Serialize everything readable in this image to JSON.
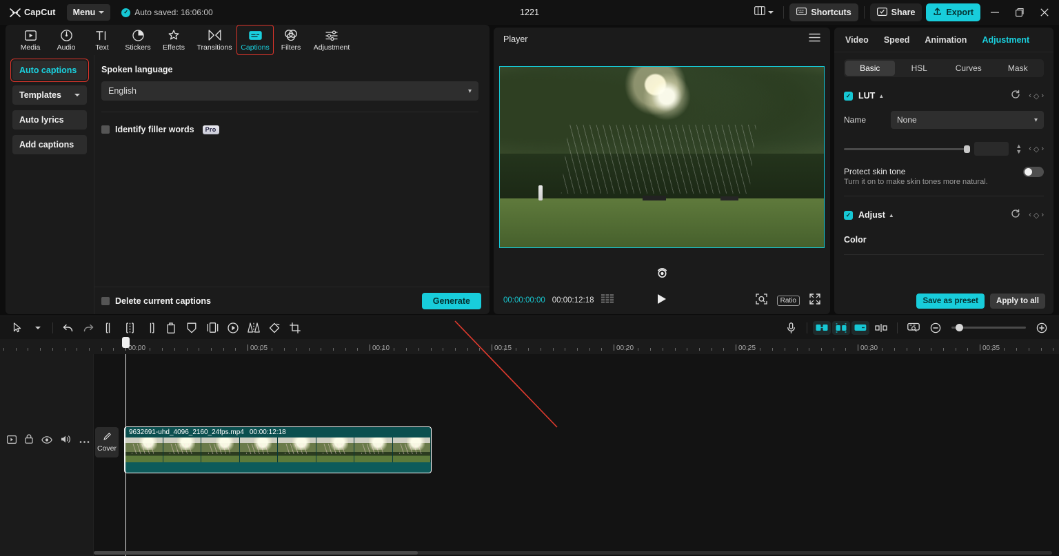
{
  "top_bar": {
    "brand": "CapCut",
    "menu_label": "Menu",
    "autosave": "Auto saved: 16:06:00",
    "project_title": "1221",
    "shortcuts_label": "Shortcuts",
    "share_label": "Share",
    "export_label": "Export",
    "minimize": "—",
    "maximize": "❐",
    "close": "✕"
  },
  "toolbar": {
    "items": [
      {
        "label": "Media",
        "icon": "media-icon",
        "active": false
      },
      {
        "label": "Audio",
        "icon": "audio-icon",
        "active": false
      },
      {
        "label": "Text",
        "icon": "text-icon",
        "active": false
      },
      {
        "label": "Stickers",
        "icon": "stickers-icon",
        "active": false
      },
      {
        "label": "Effects",
        "icon": "effects-icon",
        "active": false
      },
      {
        "label": "Transitions",
        "icon": "transitions-icon",
        "active": false
      },
      {
        "label": "Captions",
        "icon": "captions-icon",
        "active": true
      },
      {
        "label": "Filters",
        "icon": "filters-icon",
        "active": false
      },
      {
        "label": "Adjustment",
        "icon": "adjustment-icon",
        "active": false
      }
    ]
  },
  "captions_panel": {
    "sidebar": [
      {
        "label": "Auto captions",
        "active": true,
        "chevron": false
      },
      {
        "label": "Templates",
        "active": false,
        "chevron": true
      },
      {
        "label": "Auto lyrics",
        "active": false,
        "chevron": false
      },
      {
        "label": "Add captions",
        "active": false,
        "chevron": false
      }
    ],
    "spoken_language_label": "Spoken language",
    "language_value": "English",
    "filler_words_label": "Identify filler words",
    "pro_badge": "Pro",
    "delete_captions_label": "Delete current captions",
    "generate_label": "Generate"
  },
  "player": {
    "title": "Player",
    "current_time": "00:00:00:00",
    "total_time": "00:00:12:18",
    "ratio_label": "Ratio"
  },
  "right_panel": {
    "tabs": [
      {
        "label": "Video",
        "active": false
      },
      {
        "label": "Speed",
        "active": false
      },
      {
        "label": "Animation",
        "active": false
      },
      {
        "label": "Adjustment",
        "active": true
      }
    ],
    "segments": [
      {
        "label": "Basic",
        "active": true
      },
      {
        "label": "HSL",
        "active": false
      },
      {
        "label": "Curves",
        "active": false
      },
      {
        "label": "Mask",
        "active": false
      }
    ],
    "lut": {
      "title": "LUT",
      "enabled": true,
      "name_label": "Name",
      "name_value": "None",
      "intensity_value": ""
    },
    "protect_skin_tone": {
      "title": "Protect skin tone",
      "subtitle": "Turn it on to make skin tones more natural.",
      "enabled": false
    },
    "adjust": {
      "title": "Adjust",
      "enabled": true,
      "color_label": "Color"
    },
    "footer": {
      "save_preset_label": "Save as preset",
      "apply_all_label": "Apply to all"
    }
  },
  "timeline": {
    "ruler_labels": [
      "00:00",
      "00:05",
      "00:10",
      "00:15",
      "00:20",
      "00:25",
      "00:30",
      "00:35"
    ],
    "cover_label": "Cover",
    "clip": {
      "filename": "9632691-uhd_4096_2160_24fps.mp4",
      "duration": "00:00:12:18"
    }
  },
  "colors": {
    "accent": "#18cddb",
    "accent_text": "#1ad0de",
    "highlight_ring": "#e0352b",
    "clip_bg": "#0d5b5b",
    "panel_bg": "#1b1b1b"
  }
}
